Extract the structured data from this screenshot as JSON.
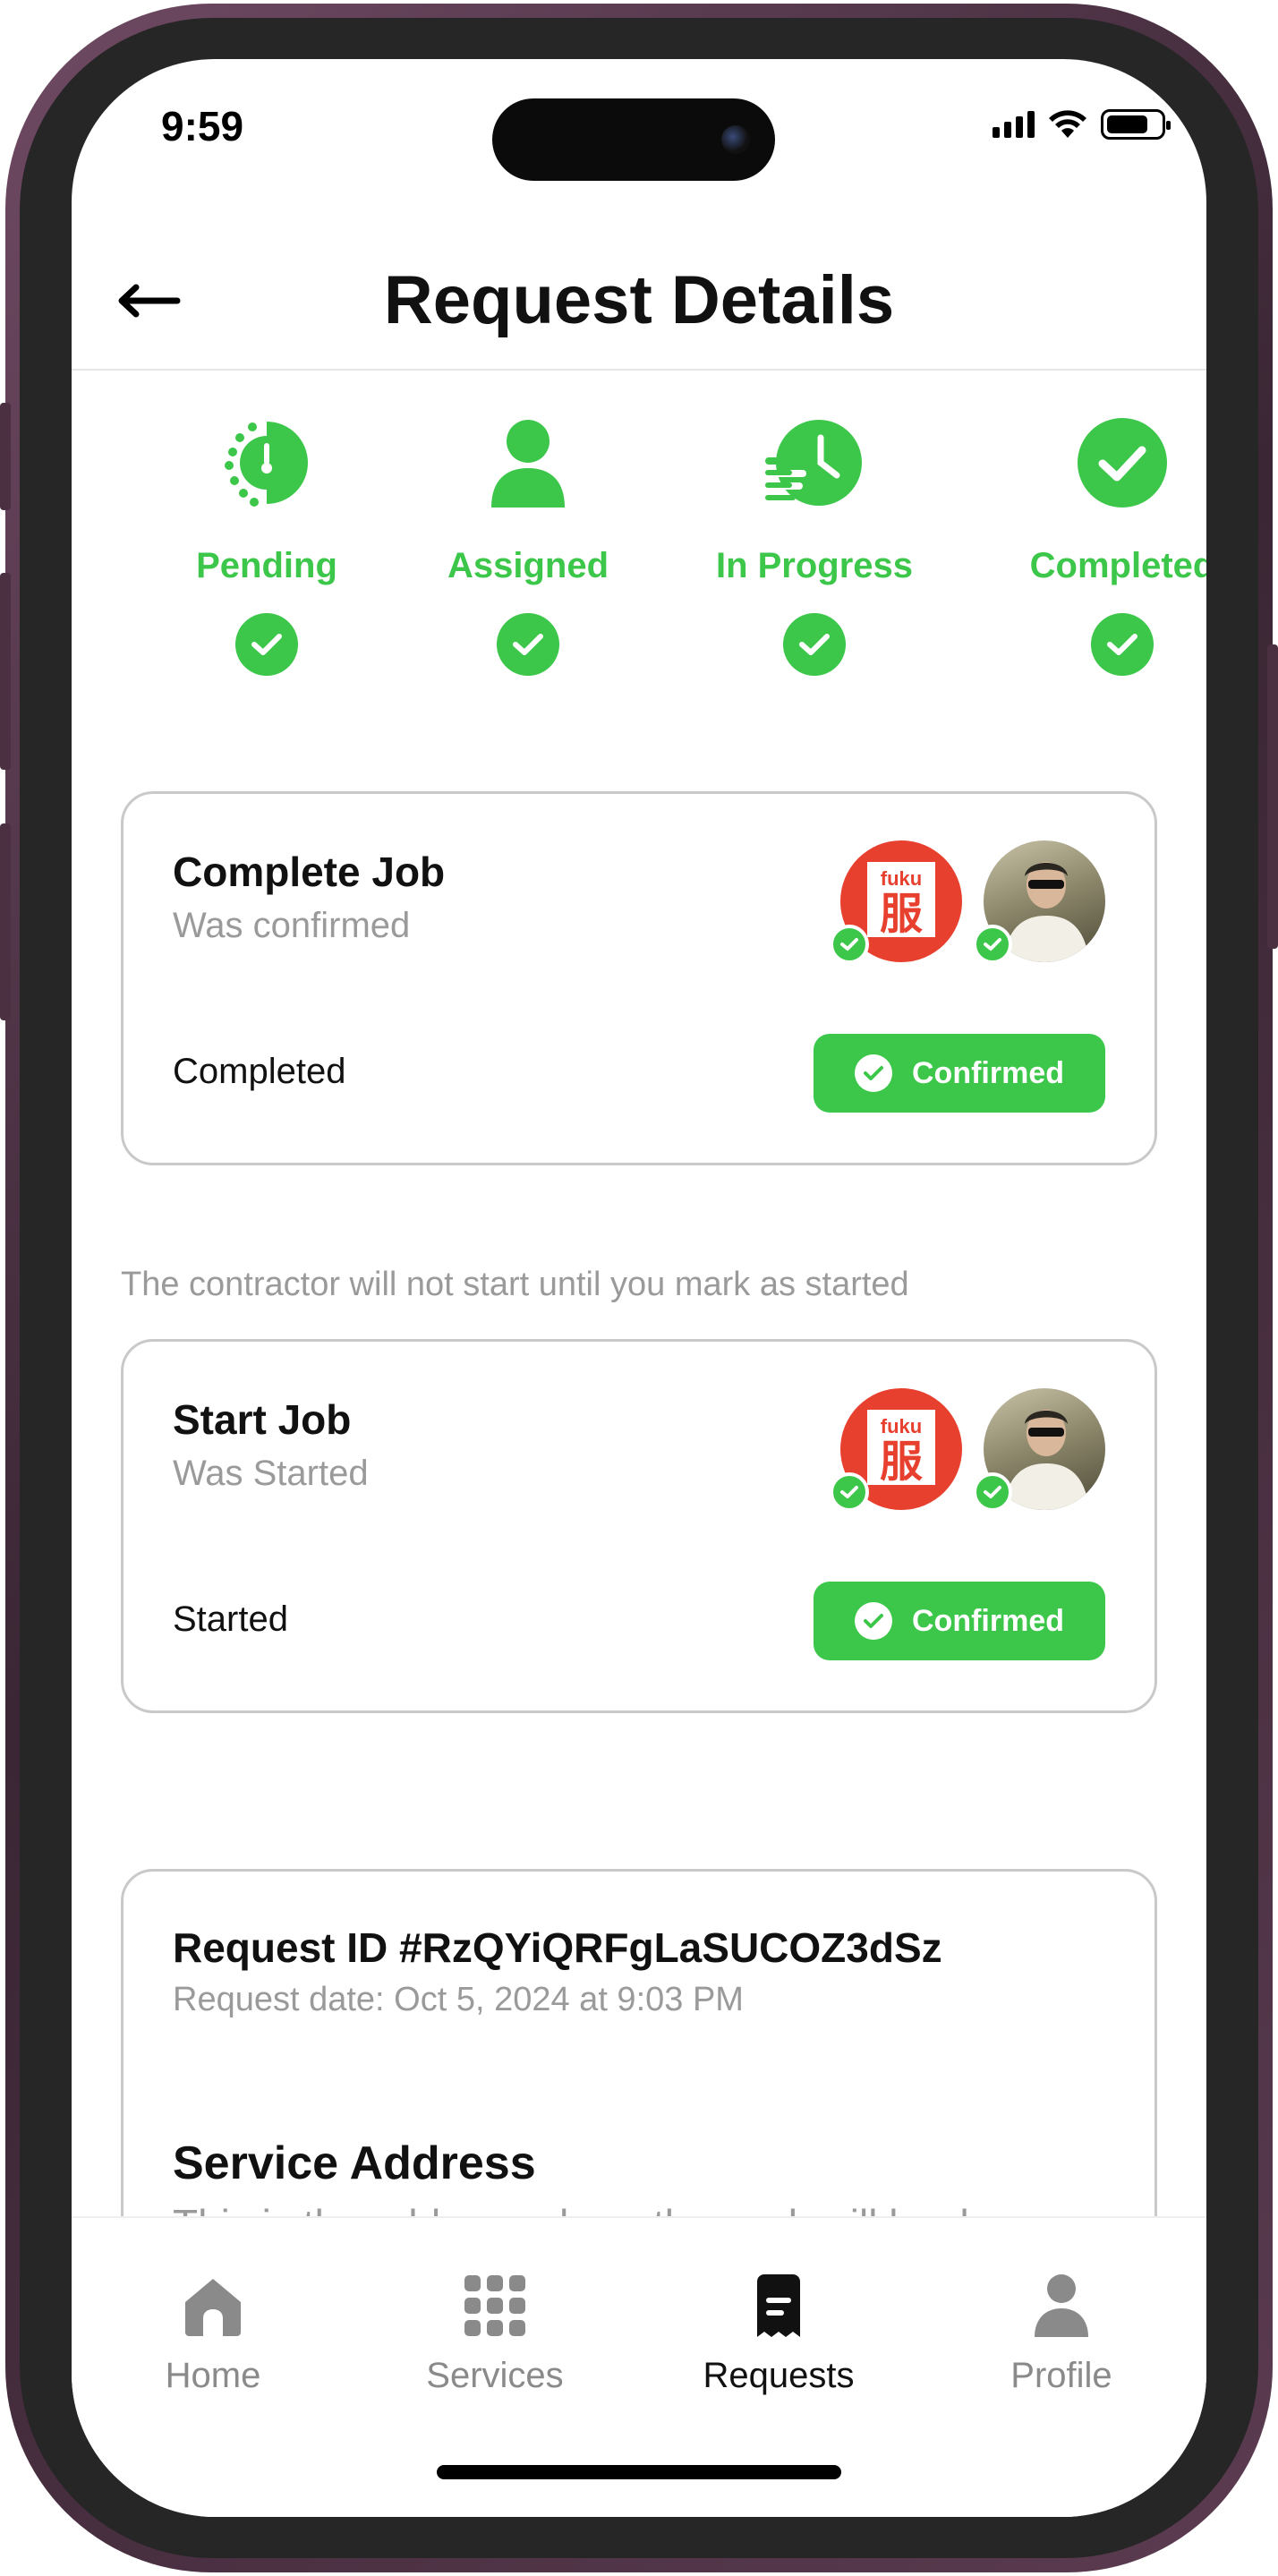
{
  "status_bar": {
    "time": "9:59"
  },
  "header": {
    "title": "Request Details",
    "back_icon": "arrow-left-icon"
  },
  "steps": [
    {
      "label": "Pending",
      "icon": "pending-icon"
    },
    {
      "label": "Assigned",
      "icon": "person-icon"
    },
    {
      "label": "In Progress",
      "icon": "progress-clock-icon"
    },
    {
      "label": "Completed",
      "icon": "check-circle-icon"
    }
  ],
  "cards": {
    "complete_job": {
      "title": "Complete Job",
      "subtitle": "Was confirmed",
      "status": "Completed",
      "button_label": "Confirmed"
    },
    "note": "The contractor will not start until you mark as started",
    "start_job": {
      "title": "Start Job",
      "subtitle": "Was Started",
      "status": "Started",
      "button_label": "Confirmed"
    },
    "request": {
      "id_label": "Request ID #RzQYiQRFgLaSUCOZ3dSz",
      "date_label": "Request date: Oct 5, 2024 at 9:03 PM",
      "service_title": "Service Address",
      "service_desc": "This is the address where the work will be done"
    }
  },
  "avatar_logo_text": {
    "top": "fuku",
    "main": "服"
  },
  "tabbar": [
    {
      "label": "Home",
      "icon": "home-icon",
      "active": false
    },
    {
      "label": "Services",
      "icon": "grid-icon",
      "active": false
    },
    {
      "label": "Requests",
      "icon": "receipt-icon",
      "active": true
    },
    {
      "label": "Profile",
      "icon": "user-icon",
      "active": false
    }
  ],
  "colors": {
    "accent": "#3cc74a",
    "muted": "#9a9a9a",
    "text": "#111111",
    "logo_red": "#e8402f"
  }
}
